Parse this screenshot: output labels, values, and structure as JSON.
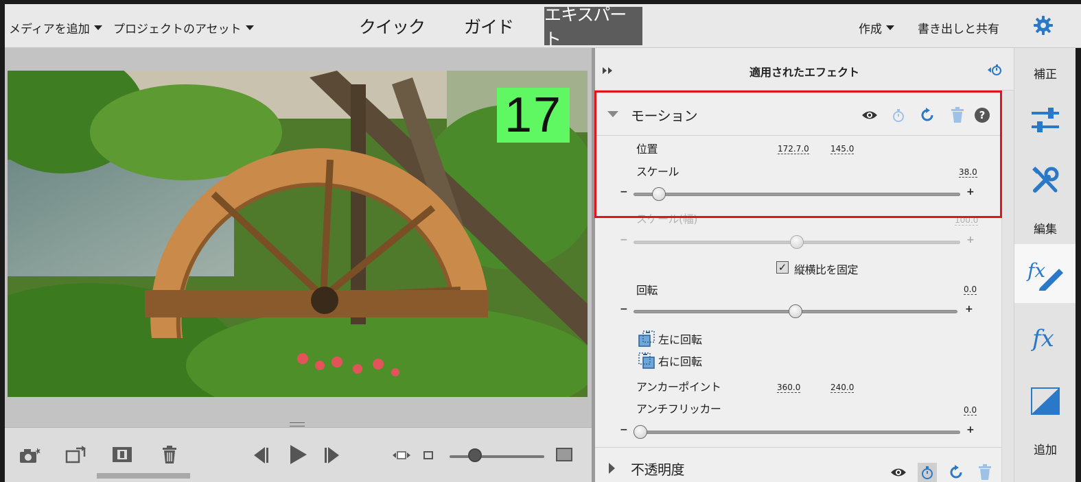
{
  "topbar": {
    "add_media": "メディアを追加",
    "project_assets": "プロジェクトのアセット",
    "modes": [
      "クイック",
      "ガイド",
      "エキスパート"
    ],
    "active_mode": "エキスパート",
    "create": "作成",
    "export_share": "書き出しと共有"
  },
  "monitor": {
    "frame_number": "17"
  },
  "panel": {
    "title": "適用されたエフェクト",
    "motion": {
      "title": "モーション",
      "position_label": "位置",
      "position_x": "172.7.0",
      "position_y": "145.0",
      "scale_label": "スケール",
      "scale_value": "38.0",
      "scale_width_label": "スケール(幅)",
      "scale_width_value": "100.0",
      "uniform_scale_label": "縦横比を固定",
      "rotation_label": "回転",
      "rotation_value": "0.0",
      "rotate_left": "左に回転",
      "rotate_right": "右に回転",
      "anchor_label": "アンカーポイント",
      "anchor_x": "360.0",
      "anchor_y": "240.0",
      "antiflicker_label": "アンチフリッカー",
      "antiflicker_value": "0.0",
      "minus": "−",
      "plus": "+"
    },
    "opacity": {
      "title": "不透明度"
    },
    "sliders": {
      "scale": 0.06,
      "scale_width": 0.5,
      "rotation": 0.5,
      "antiflicker": 0.0
    }
  },
  "rail": {
    "adjust_label": "補正",
    "edit_label": "編集",
    "add_label": "追加"
  },
  "colors": {
    "accent_blue": "#2a78c8",
    "highlight_red": "#e0151b",
    "frame_green": "#60f862"
  }
}
